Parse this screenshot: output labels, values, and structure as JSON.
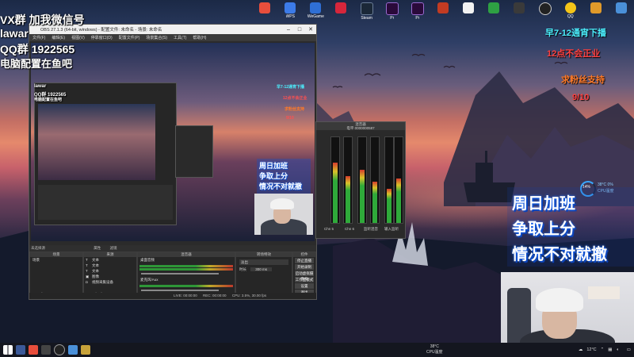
{
  "overlay_left": {
    "line1": "VX群 加我微信号",
    "line2": "lawar",
    "line3": "QQ群 1922565",
    "line4": "电脑配置在鱼吧"
  },
  "overlay_right": {
    "line1": "早7-12通宵下播",
    "line2": "12点不会正业",
    "line3": "求粉丝支持",
    "line4": "9/10",
    "banner1": "周日加班",
    "banner2": "争取上分",
    "banner3": "情况不对就撤"
  },
  "cpu_widget": {
    "percent": "14%",
    "temp": "38°C  0%",
    "label": "CPU温度"
  },
  "desktop_icons": [
    {
      "label": "",
      "color": "#e84e3c"
    },
    {
      "label": "WPS",
      "color": "#3c7be8"
    },
    {
      "label": "WeGame",
      "color": "#2f6fd4"
    },
    {
      "label": "",
      "color": "#d6263b"
    },
    {
      "label": "Steam",
      "color": "#1b2838"
    },
    {
      "label": "Pr",
      "color": "#2a0a3a"
    },
    {
      "label": "Pr",
      "color": "#2a0a3a"
    },
    {
      "label": "",
      "color": "#c23b22"
    },
    {
      "label": "",
      "color": "#f2f2f2"
    },
    {
      "label": "",
      "color": "#2ea043"
    },
    {
      "label": "",
      "color": "#3a3a3a"
    },
    {
      "label": "",
      "color": "#222"
    },
    {
      "label": "QQ",
      "color": "#f5c518"
    },
    {
      "label": "",
      "color": "#e09a2a"
    },
    {
      "label": "",
      "color": "#4a90d9"
    }
  ],
  "obs": {
    "title": "OBS 27.1.3 (64-bit, windows) - 配置文件: 未命名 - 场景: 未命名",
    "menu": [
      "文件(F)",
      "编辑(E)",
      "视图(V)",
      "停靠窗口(D)",
      "配置文件(P)",
      "场景集合(S)",
      "工具(T)",
      "帮助(H)"
    ],
    "no_source": "未选择源",
    "attr_btn": "属性",
    "filter_btn": "滤镜",
    "docks": {
      "scenes": "场景",
      "sources": "来源",
      "mixer": "混音器",
      "transitions": "转场特效",
      "controls": "控件"
    },
    "scene_items": [
      "场景"
    ],
    "source_items": [
      "文本",
      "文本",
      "文本",
      "图像",
      "视频采集设备"
    ],
    "mixer_items": [
      "桌面音频",
      "麦克风/Aux"
    ],
    "transition": {
      "type": "淡出",
      "duration_label": "时长",
      "duration": "300 ms"
    },
    "controls": [
      "停止直播",
      "开始录制",
      "启动虚拟摄像机",
      "工作室模式",
      "设置",
      "退出"
    ],
    "status": {
      "live": "LIVE: 00:00:00",
      "rec": "REC: 00:00:00",
      "cpu": "CPU: 3.5%, 30.00 fps"
    }
  },
  "mixer_panel": {
    "title": "混音器",
    "subtitle": "电平 0000000587",
    "channels": [
      "Chn 5",
      "Chn 6",
      "监听混音",
      "输入监听"
    ]
  },
  "taskbar": {
    "temp": "12°C",
    "time": "",
    "cpu_temp": "38°C",
    "cpu_label": "CPU温度"
  }
}
